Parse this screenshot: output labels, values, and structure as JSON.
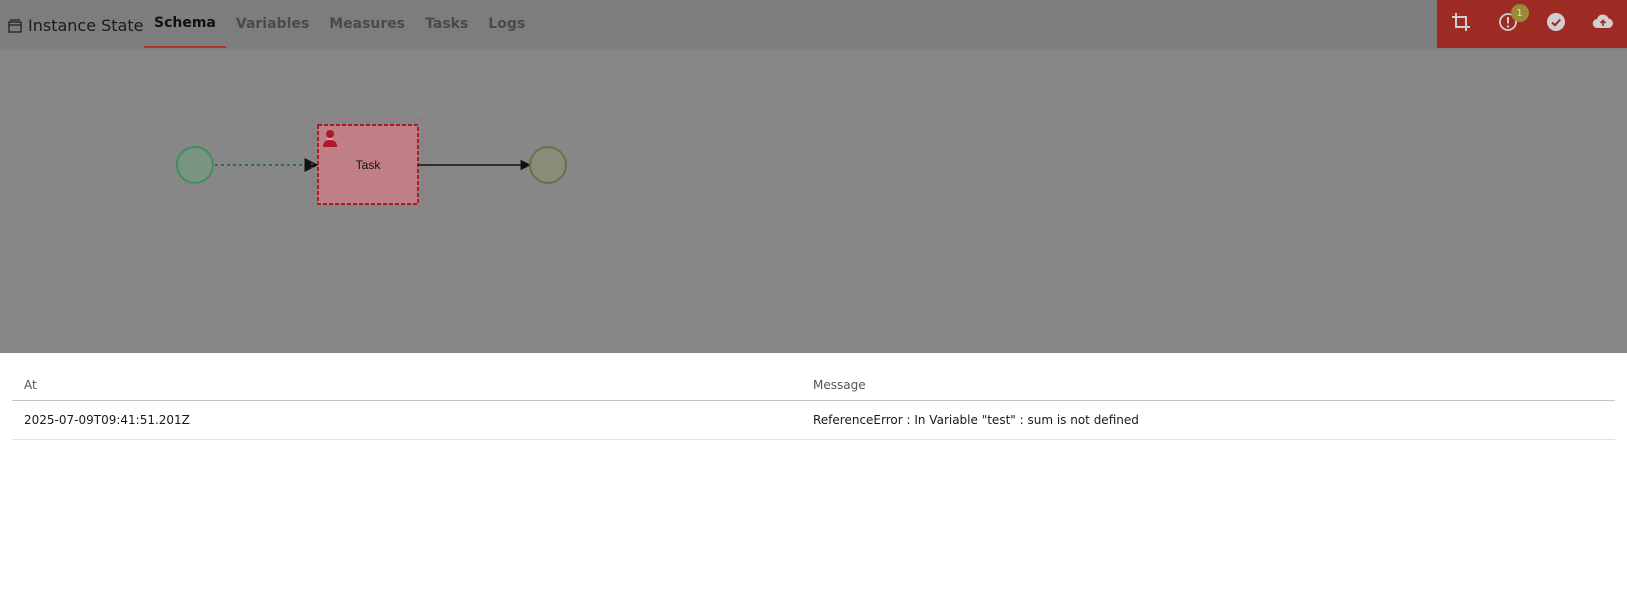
{
  "header": {
    "title": "Instance State",
    "title_icon": "window-icon",
    "tabs": [
      {
        "label": "Schema",
        "active": true
      },
      {
        "label": "Variables",
        "active": false
      },
      {
        "label": "Measures",
        "active": false
      },
      {
        "label": "Tasks",
        "active": false
      },
      {
        "label": "Logs",
        "active": false
      }
    ],
    "toolbar": {
      "icons": [
        "crop-icon",
        "alert-circle-icon",
        "check-circle-icon",
        "cloud-upload-icon"
      ],
      "alert_count": "1"
    }
  },
  "diagram": {
    "task_label": "Task",
    "task_icon": "user-task-icon"
  },
  "logs": {
    "columns": [
      "At",
      "Message"
    ],
    "rows": [
      {
        "at": "2025-07-09T09:41:51.201Z",
        "message": "ReferenceError : In Variable \"test\" : sum is not defined"
      }
    ]
  },
  "colors": {
    "header_bg": "#7d7d7d",
    "toolbar_bg": "#9e2a24",
    "active_tab_underline": "#b5302a",
    "start_event": "#3f8f5a",
    "task_border": "#b0182a",
    "task_fill": "#c07f85"
  }
}
